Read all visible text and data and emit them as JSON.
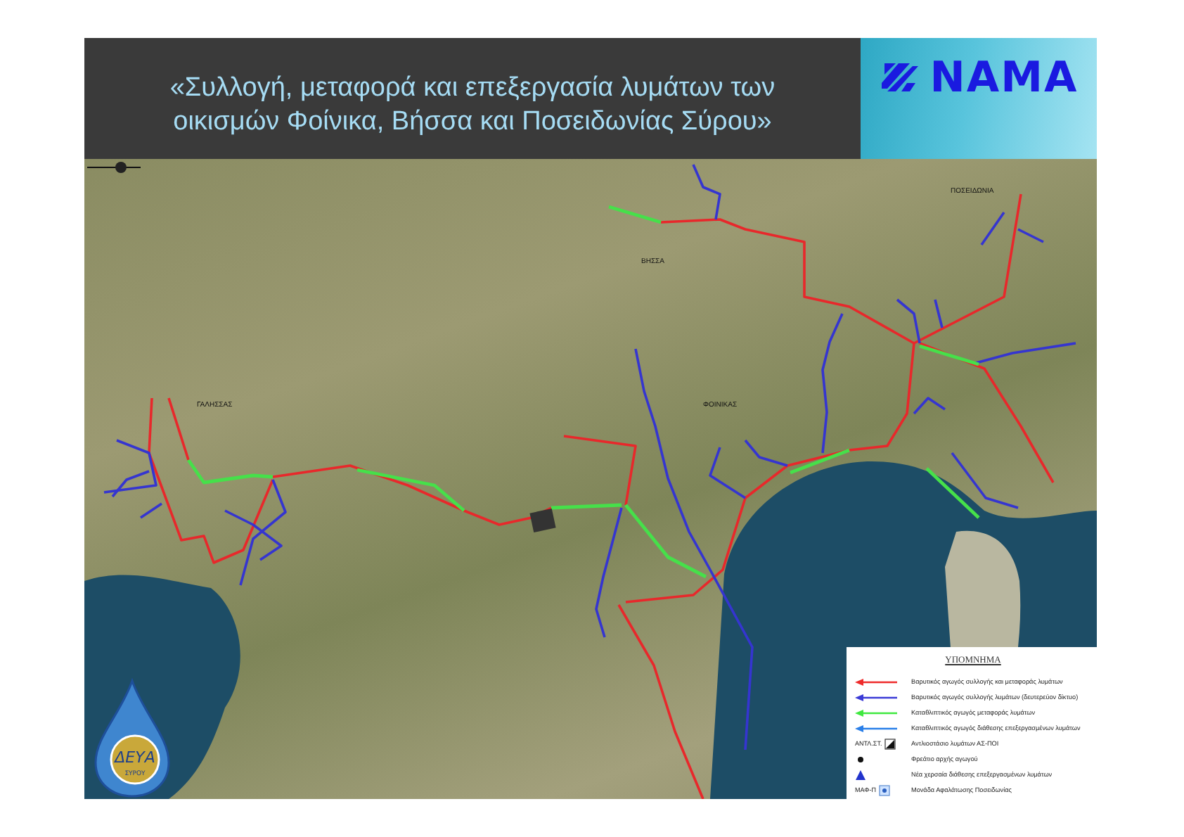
{
  "header": {
    "title_lines": [
      "«Συλλογή, μεταφορά και επεξεργασία λυμάτων των",
      "οικισμών Φοίνικα, Βήσσα και Ποσειδωνίας Σύρου»"
    ],
    "logo_text": "NAMA"
  },
  "map": {
    "place_labels": [
      "ΓΑΛΗΣΣΑΣ",
      "ΒΗΣΣΑ",
      "ΦΟΙΝΙΚΑΣ",
      "ΠΟΣΕΙΔΩΝΙΑ"
    ]
  },
  "legend": {
    "title": "ΥΠΟΜΝΗΜΑ",
    "items": [
      {
        "kind": "line",
        "color": "#ee2b2b",
        "label": "Βαρυτικός αγωγός συλλογής και μεταφοράς λυμάτων"
      },
      {
        "kind": "line",
        "color": "#3b3bd6",
        "label": "Βαρυτικός αγωγός συλλογής λυμάτων (δευτερεύον δίκτυο)"
      },
      {
        "kind": "line",
        "color": "#3fe83f",
        "label": "Καταθλιπτικός αγωγός μεταφοράς λυμάτων"
      },
      {
        "kind": "line",
        "color": "#2a7fe8",
        "label": "Καταθλιπτικός αγωγός διάθεσης επεξεργασμένων λυμάτων"
      },
      {
        "kind": "pump",
        "prefix": "ΑΝΤΛ.ΣΤ.",
        "label": "Αντλιοστάσιο λυμάτων ΑΣ-ΠΟΙ"
      },
      {
        "kind": "dot",
        "label": "Φρεάτιο αρχής αγωγού"
      },
      {
        "kind": "triangle",
        "label": "Νέα χερσαία διάθεσης επεξεργασμένων λυμάτων"
      },
      {
        "kind": "plant",
        "prefix": "ΜΑΦ-Π",
        "label": "Μονάδα Αφαλάτωσης Ποσειδωνίας"
      }
    ]
  },
  "badge": {
    "top": "ΔΕΥΑ",
    "bottom": "ΣΥΡΟΥ"
  }
}
